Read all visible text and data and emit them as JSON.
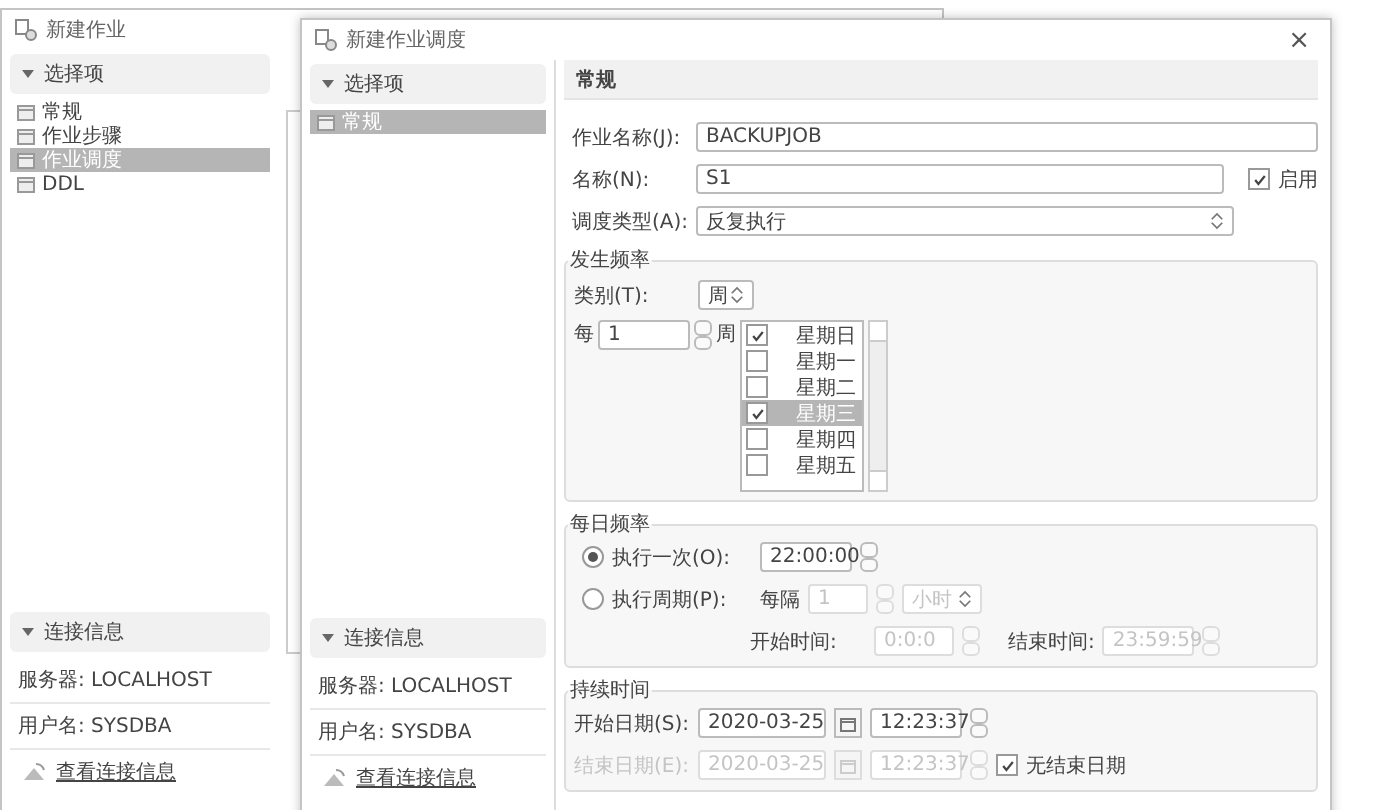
{
  "back_window": {
    "title": "新建作业",
    "sidebar": {
      "header": "选择项",
      "items": [
        {
          "label": "常规",
          "selected": false
        },
        {
          "label": "作业步骤",
          "selected": false
        },
        {
          "label": "作业调度",
          "selected": true
        },
        {
          "label": "DDL",
          "selected": false
        }
      ]
    },
    "connection": {
      "header": "连接信息",
      "server": "服务器: LOCALHOST",
      "user": "用户名: SYSDBA",
      "link": "查看连接信息"
    }
  },
  "dialog": {
    "title": "新建作业调度",
    "close": "×",
    "sidebar": {
      "header": "选择项",
      "items": [
        {
          "label": "常规",
          "selected": true
        }
      ]
    },
    "connection": {
      "header": "连接信息",
      "server": "服务器: LOCALHOST",
      "user": "用户名: SYSDBA",
      "link": "查看连接信息"
    },
    "section_title": "常规",
    "job_name": {
      "label": "作业名称(J):",
      "value": "BACKUPJOB"
    },
    "name": {
      "label": "名称(N):",
      "value": "S1"
    },
    "enabled": {
      "label": "启用",
      "checked": true
    },
    "schedule_type": {
      "label": "调度类型(A):",
      "value": "反复执行"
    },
    "frequency": {
      "title": "发生频率",
      "category": {
        "label": "类别(T):",
        "value": "周"
      },
      "every_label": "每",
      "every_value": "1",
      "unit": "周",
      "days": [
        {
          "label": "星期日",
          "checked": true,
          "selected": false
        },
        {
          "label": "星期一",
          "checked": false,
          "selected": false
        },
        {
          "label": "星期二",
          "checked": false,
          "selected": false
        },
        {
          "label": "星期三",
          "checked": true,
          "selected": true
        },
        {
          "label": "星期四",
          "checked": false,
          "selected": false
        },
        {
          "label": "星期五",
          "checked": false,
          "selected": false
        }
      ]
    },
    "daily": {
      "title": "每日频率",
      "once": {
        "label": "执行一次(O):",
        "selected": true,
        "time": "22:00:00"
      },
      "periodic": {
        "label": "执行周期(P):",
        "selected": false,
        "interval_label": "每隔",
        "interval": "1",
        "unit": "小时",
        "start_label": "开始时间:",
        "start": "0:0:0",
        "end_label": "结束时间:",
        "end": "23:59:59"
      }
    },
    "duration": {
      "title": "持续时间",
      "start": {
        "label": "开始日期(S):",
        "date": "2020-03-25",
        "time": "12:23:37"
      },
      "end": {
        "label": "结束日期(E):",
        "date": "2020-03-25",
        "time": "12:23:37"
      },
      "no_end": {
        "label": "无结束日期",
        "checked": true
      }
    }
  }
}
